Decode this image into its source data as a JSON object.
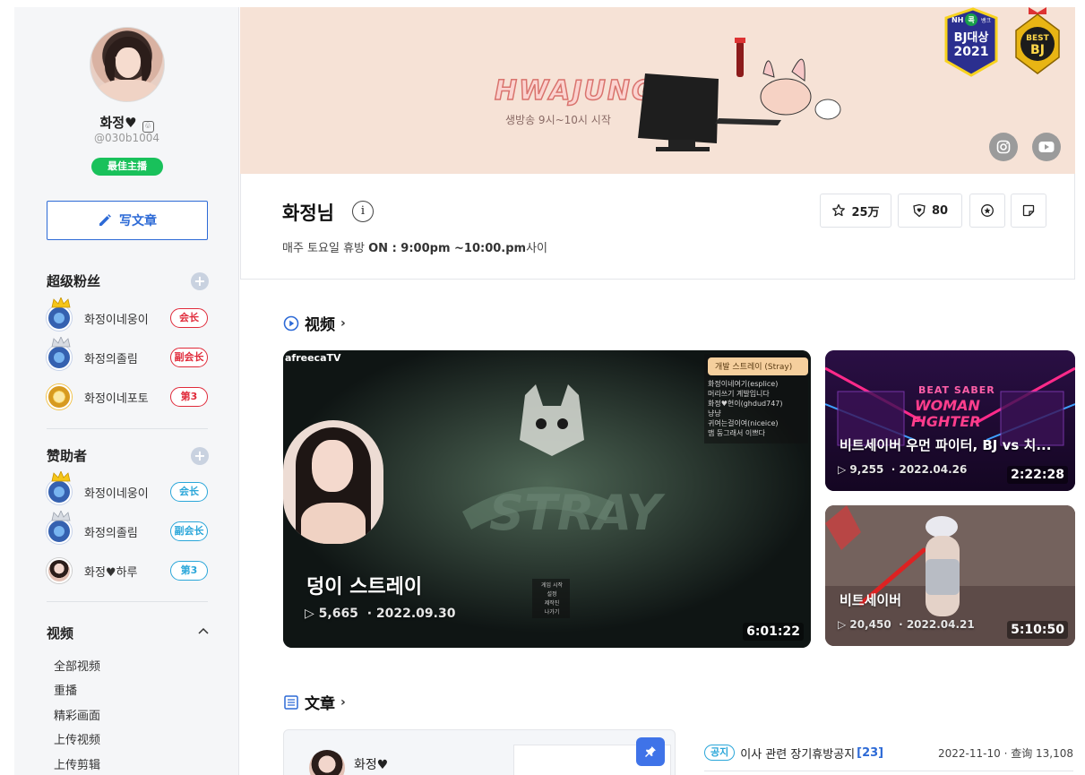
{
  "profile": {
    "name": "화정♥",
    "id": "@030b1004",
    "badge": "最佳主播",
    "write_label": "写文章"
  },
  "super_fans": {
    "title": "超级粉丝",
    "items": [
      {
        "name": "화정이네웅이",
        "role": "会长"
      },
      {
        "name": "화정의졸림",
        "role": "副会长"
      },
      {
        "name": "화정이네포토",
        "role": "第3"
      }
    ]
  },
  "sponsors": {
    "title": "赞助者",
    "items": [
      {
        "name": "화정이네웅이",
        "role": "会长"
      },
      {
        "name": "화정의졸림",
        "role": "副会长"
      },
      {
        "name": "화정♥하루",
        "role": "第3"
      }
    ]
  },
  "menu": {
    "title": "视频",
    "items": [
      "全部视频",
      "重播",
      "精彩画面",
      "上传视频",
      "上传剪辑"
    ]
  },
  "banner": {
    "logo": "HWAJUNG",
    "subtitle": "생방송 9시~10시 시작",
    "award_lines": [
      "NH",
      "콕",
      "뱅크",
      "BJ대상",
      "2021"
    ],
    "best_lines": [
      "BEST",
      "BJ"
    ]
  },
  "station": {
    "name": "화정님",
    "info_icon": "i",
    "desc_prefix": "매주 토요일 휴방 ",
    "desc_bold": "ON : 9:00pm ~10:00.pm",
    "desc_suffix": "사이",
    "favorites": "25万",
    "fans": "80"
  },
  "videos": {
    "title": "视频",
    "main": {
      "title": "덩이 스트레이",
      "views": "▷ 5,665",
      "date": "· 2022.09.30",
      "duration": "6:01:22",
      "watermark": "afreecaTV",
      "chat_header": "개발 스트레이 (Stray)",
      "chat_lines": [
        "화정이네여기(esplice)",
        "머리쓰기 계발입니다",
        "화정♥현이(ghdud747)",
        "냥냥",
        "귀여는걸이여(niceice)",
        "맴 둥그래서 이쁘다"
      ],
      "menu_lines": [
        "게임 시작",
        "설정",
        "제작진",
        "나가기"
      ]
    },
    "side": [
      {
        "title": "비트세이버 우먼 파이터, BJ vs 치...",
        "views": "▷ 9,255",
        "date": "· 2022.04.26",
        "duration": "2:22:28",
        "art_top": "BEAT SABER",
        "art_mid": "WOMAN",
        "art_bottom": "FIGHTER"
      },
      {
        "title": "비트세이버",
        "views": "▷ 20,450",
        "date": "· 2022.04.21",
        "duration": "5:10:50"
      }
    ]
  },
  "posts": {
    "title": "文章",
    "author": "화정♥",
    "notice": {
      "tag": "공지",
      "title": "이사 관련 장기휴방공지",
      "count": "[23]",
      "date": "2022-11-10",
      "views": "· 查询 13,108"
    }
  },
  "colors": {
    "accent": "#2d6ad6",
    "green": "#19c15b",
    "red": "#e02a3a",
    "cyan": "#2aa6d9",
    "banner_bg": "#f6e2d6"
  }
}
